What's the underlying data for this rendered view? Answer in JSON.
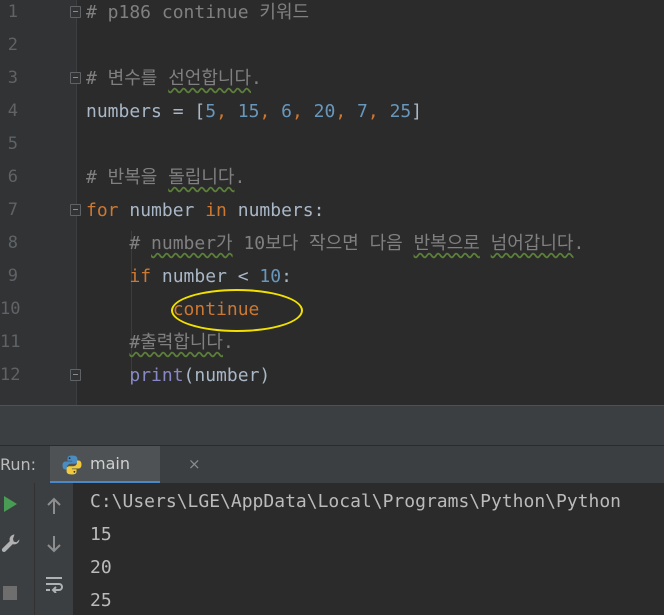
{
  "editor": {
    "lines": [
      {
        "n": "1",
        "fold": true,
        "tokens": [
          {
            "t": "# p186 continue 키워드",
            "c": "tok-comment"
          }
        ]
      },
      {
        "n": "2",
        "tokens": []
      },
      {
        "n": "3",
        "fold": true,
        "tokens": [
          {
            "t": "# 변수를 ",
            "c": "tok-comment"
          },
          {
            "t": "선언합니다",
            "c": "tok-comment typo"
          },
          {
            "t": ".",
            "c": "tok-comment"
          }
        ]
      },
      {
        "n": "4",
        "tokens": [
          {
            "t": "numbers = [",
            "c": "tok-plain"
          },
          {
            "t": "5",
            "c": "tok-num"
          },
          {
            "t": ", ",
            "c": "tok-punct"
          },
          {
            "t": "15",
            "c": "tok-num"
          },
          {
            "t": ", ",
            "c": "tok-punct"
          },
          {
            "t": "6",
            "c": "tok-num"
          },
          {
            "t": ", ",
            "c": "tok-punct"
          },
          {
            "t": "20",
            "c": "tok-num"
          },
          {
            "t": ", ",
            "c": "tok-punct"
          },
          {
            "t": "7",
            "c": "tok-num"
          },
          {
            "t": ", ",
            "c": "tok-punct"
          },
          {
            "t": "25",
            "c": "tok-num"
          },
          {
            "t": "]",
            "c": "tok-plain"
          }
        ]
      },
      {
        "n": "5",
        "tokens": []
      },
      {
        "n": "6",
        "tokens": [
          {
            "t": "# 반복을 ",
            "c": "tok-comment"
          },
          {
            "t": "돌립니다",
            "c": "tok-comment typo"
          },
          {
            "t": ".",
            "c": "tok-comment"
          }
        ]
      },
      {
        "n": "7",
        "fold": true,
        "tokens": [
          {
            "t": "for",
            "c": "tok-kw"
          },
          {
            "t": " number ",
            "c": "tok-plain"
          },
          {
            "t": "in",
            "c": "tok-kw"
          },
          {
            "t": " numbers:",
            "c": "tok-plain"
          }
        ]
      },
      {
        "n": "8",
        "tokens": [
          {
            "t": "    # ",
            "c": "tok-comment"
          },
          {
            "t": "number가",
            "c": "tok-comment typo"
          },
          {
            "t": " 10보다 작으면 다음 ",
            "c": "tok-comment"
          },
          {
            "t": "반복으로",
            "c": "tok-comment typo"
          },
          {
            "t": " ",
            "c": "tok-comment"
          },
          {
            "t": "넘어갑니다",
            "c": "tok-comment typo"
          },
          {
            "t": ".",
            "c": "tok-comment"
          }
        ]
      },
      {
        "n": "9",
        "tokens": [
          {
            "t": "    ",
            "c": "tok-plain"
          },
          {
            "t": "if",
            "c": "tok-kw"
          },
          {
            "t": " number < ",
            "c": "tok-plain"
          },
          {
            "t": "10",
            "c": "tok-num"
          },
          {
            "t": ":",
            "c": "tok-plain"
          }
        ]
      },
      {
        "n": "10",
        "tokens": [
          {
            "t": "        ",
            "c": "tok-plain"
          },
          {
            "t": "continue",
            "c": "tok-kw"
          }
        ]
      },
      {
        "n": "11",
        "tokens": [
          {
            "t": "    ",
            "c": "tok-plain"
          },
          {
            "t": "#출력합니다",
            "c": "tok-comment typo"
          },
          {
            "t": ".",
            "c": "tok-comment"
          }
        ]
      },
      {
        "n": "12",
        "fold": true,
        "tokens": [
          {
            "t": "    ",
            "c": "tok-plain"
          },
          {
            "t": "print",
            "c": "tok-builtin"
          },
          {
            "t": "(number)",
            "c": "tok-plain"
          }
        ]
      }
    ]
  },
  "run": {
    "label": "Run:",
    "tab_label": "main",
    "close_glyph": "×",
    "icons": [
      "play-icon",
      "wrench-icon",
      "stop-icon",
      "arrow-up-icon",
      "arrow-down-icon",
      "soft-wrap-icon"
    ],
    "output": [
      "C:\\Users\\LGE\\AppData\\Local\\Programs\\Python\\Python",
      "15",
      "20",
      "25"
    ]
  },
  "colors": {
    "editor_bg": "#2b2b2b",
    "keyword": "#cc7832",
    "number": "#6897bb",
    "comment": "#808080",
    "highlight_circle": "#f2e100",
    "run_icon": "#499c54"
  }
}
